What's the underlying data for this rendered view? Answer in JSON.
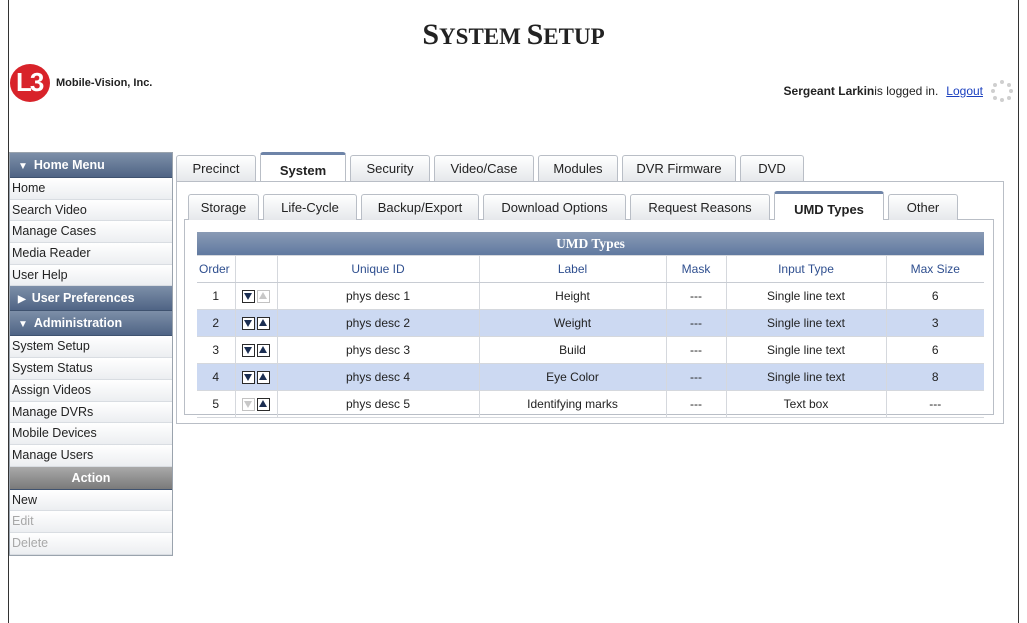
{
  "page": {
    "title_first": "S",
    "title_rest1": "YSTEM ",
    "title_second": "S",
    "title_rest2": "ETUP"
  },
  "brand": {
    "logo_mark": "L3",
    "company": "Mobile-Vision, Inc."
  },
  "session": {
    "user": "Sergeant Larkin",
    "status_text": " is logged in.",
    "logout_label": "Logout"
  },
  "sidebar": {
    "home_menu": {
      "title": "Home Menu",
      "items": [
        "Home",
        "Search Video",
        "Manage Cases",
        "Media Reader",
        "User Help"
      ]
    },
    "user_prefs": {
      "title": "User Preferences"
    },
    "administration": {
      "title": "Administration",
      "items": [
        "System Setup",
        "System Status",
        "Assign Videos",
        "Manage DVRs",
        "Mobile Devices",
        "Manage Users"
      ]
    },
    "action": {
      "title": "Action",
      "items": [
        "New",
        "Edit",
        "Delete"
      ],
      "disabled": [
        "Edit",
        "Delete"
      ]
    }
  },
  "main_tabs": [
    "Precinct",
    "System",
    "Security",
    "Video/Case",
    "Modules",
    "DVR Firmware",
    "DVD"
  ],
  "main_tab_active": "System",
  "sub_tabs": [
    "Storage",
    "Life-Cycle",
    "Backup/Export",
    "Download Options",
    "Request Reasons",
    "UMD Types",
    "Other"
  ],
  "sub_tab_active": "UMD Types",
  "table": {
    "title": "UMD Types",
    "headers": {
      "order": "Order",
      "unique_id": "Unique ID",
      "label": "Label",
      "mask": "Mask",
      "input_type": "Input Type",
      "max_size": "Max Size"
    },
    "rows": [
      {
        "order": "1",
        "unique_id": "phys desc 1",
        "label": "Height",
        "mask": "---",
        "input_type": "Single line text",
        "max_size": "6"
      },
      {
        "order": "2",
        "unique_id": "phys desc 2",
        "label": "Weight",
        "mask": "---",
        "input_type": "Single line text",
        "max_size": "3"
      },
      {
        "order": "3",
        "unique_id": "phys desc 3",
        "label": "Build",
        "mask": "---",
        "input_type": "Single line text",
        "max_size": "6"
      },
      {
        "order": "4",
        "unique_id": "phys desc 4",
        "label": "Eye Color",
        "mask": "---",
        "input_type": "Single line text",
        "max_size": "8"
      },
      {
        "order": "5",
        "unique_id": "phys desc 5",
        "label": "Identifying marks",
        "mask": "---",
        "input_type": "Text box",
        "max_size": "---"
      }
    ]
  },
  "colors": {
    "header_blue": "#6079a0",
    "row_alt": "#ccd9f2",
    "link": "#1a3fbf",
    "logo_red": "#d8232a"
  }
}
